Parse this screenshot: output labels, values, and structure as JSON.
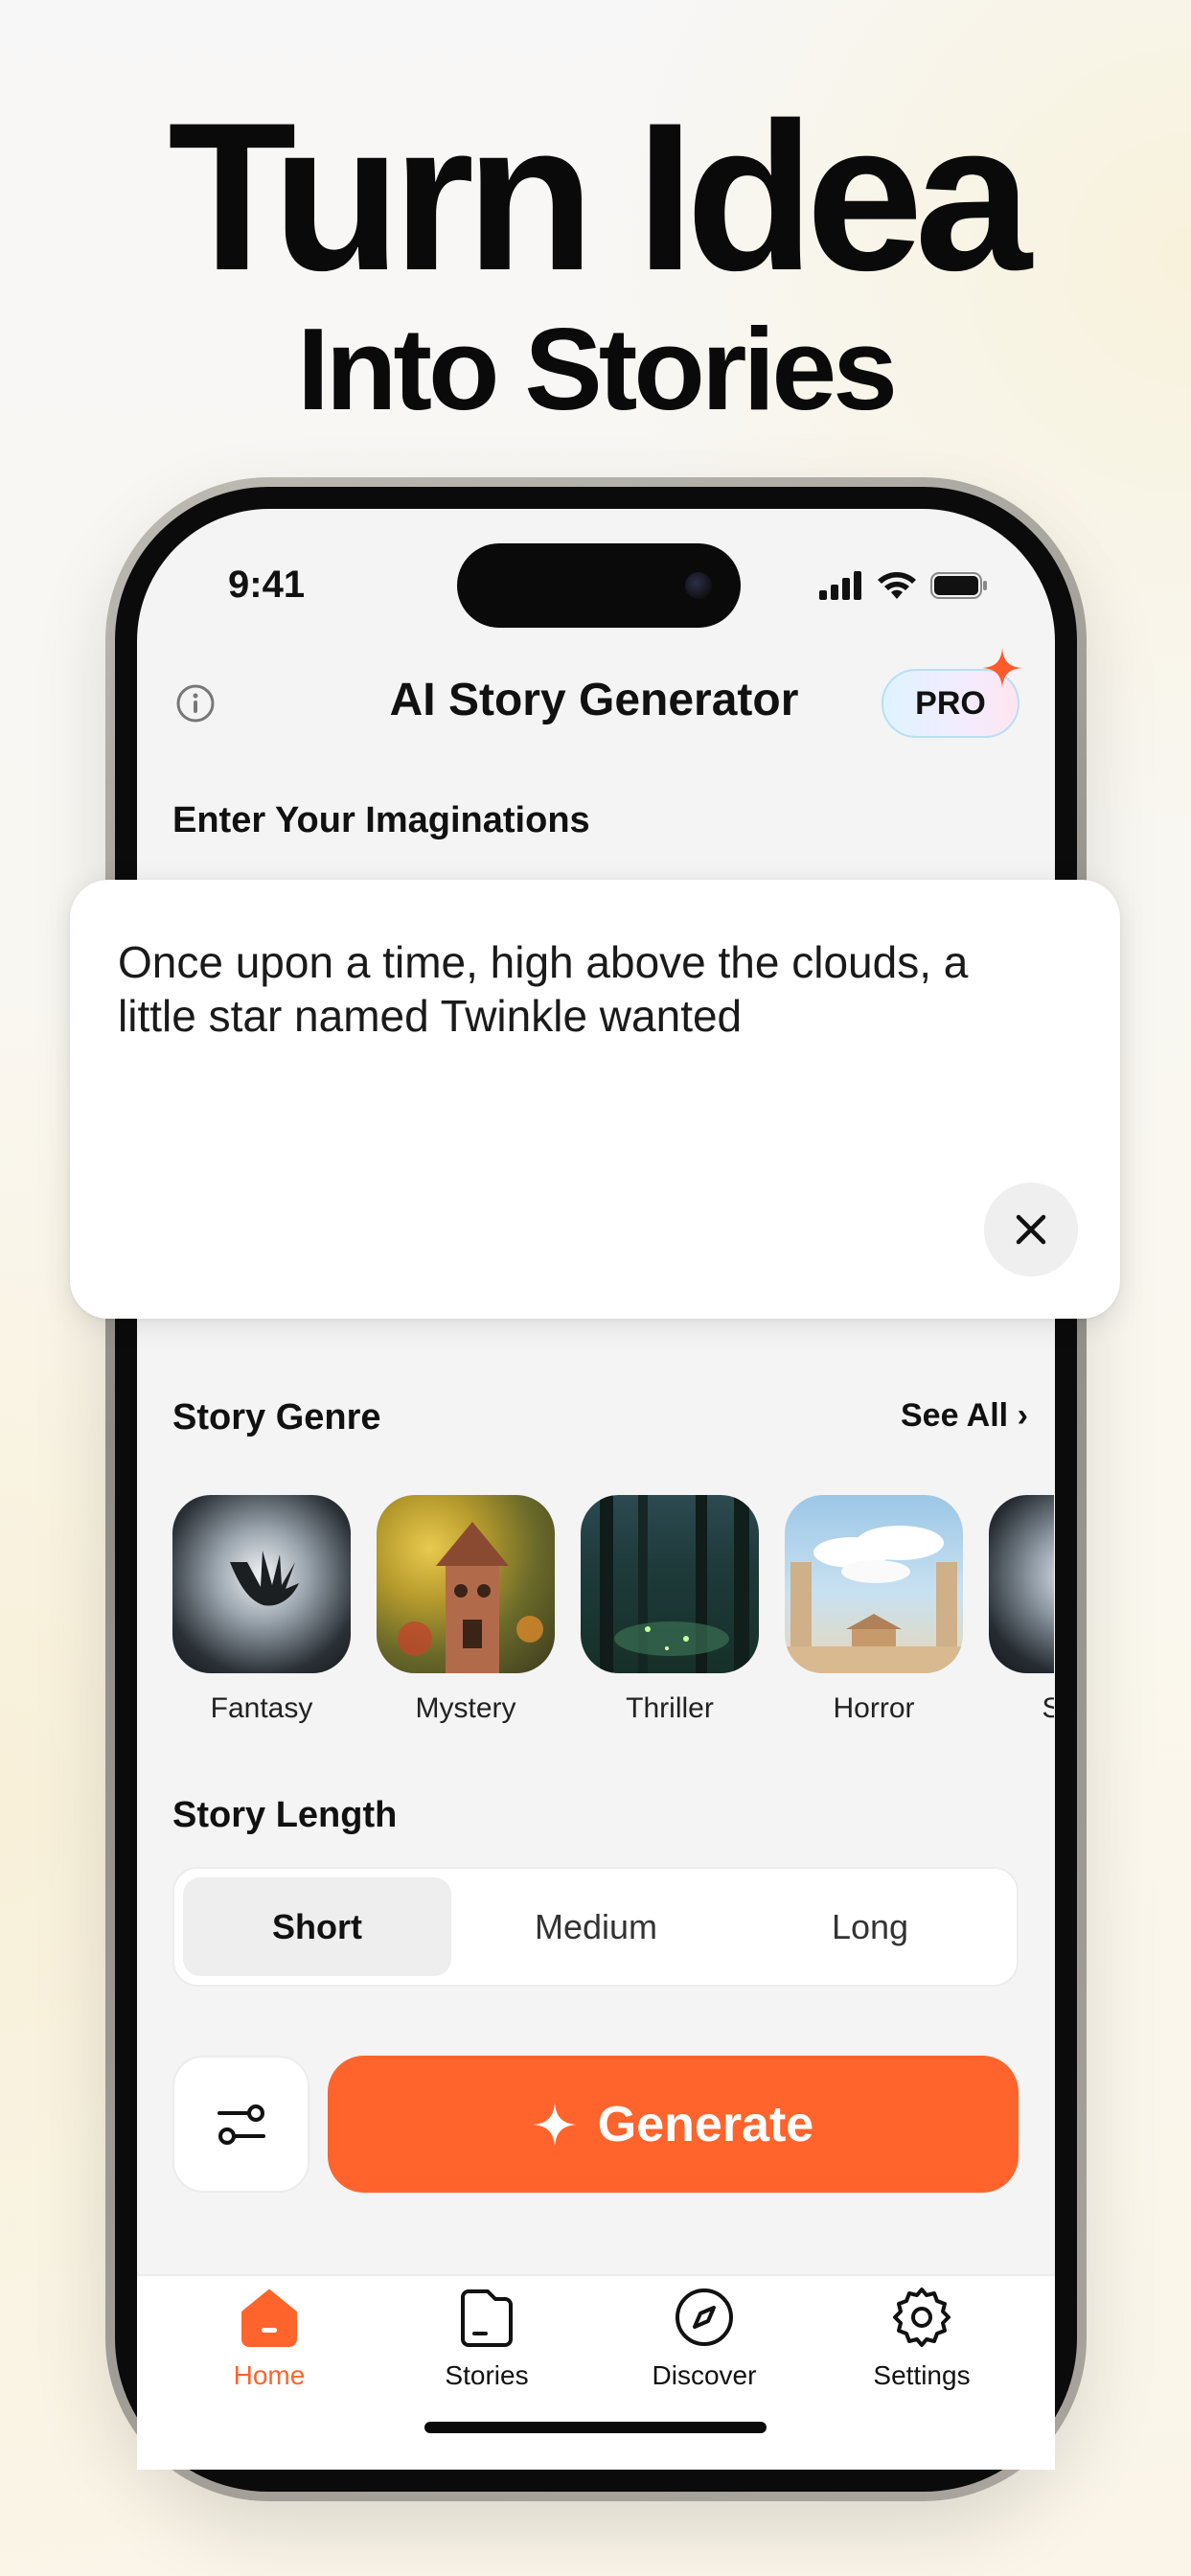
{
  "headline": {
    "line1": "Turn Idea",
    "line2": "Into Stories"
  },
  "status_bar": {
    "time": "9:41"
  },
  "header": {
    "title": "AI Story Generator",
    "pro_label": "PRO"
  },
  "prompt": {
    "label": "Enter Your Imaginations",
    "text": "Once upon a time, high above the clouds, a little star named Twinkle wanted"
  },
  "genre": {
    "label": "Story Genre",
    "see_all": "See All",
    "items": [
      {
        "name": "Fantasy"
      },
      {
        "name": "Mystery"
      },
      {
        "name": "Thriller"
      },
      {
        "name": "Horror"
      },
      {
        "name": "Scien"
      }
    ]
  },
  "length": {
    "label": "Story Length",
    "options": [
      "Short",
      "Medium",
      "Long"
    ],
    "selected": "Short"
  },
  "actions": {
    "generate_label": "Generate"
  },
  "tabs": [
    {
      "label": "Home",
      "icon": "home-icon",
      "active": true
    },
    {
      "label": "Stories",
      "icon": "folder-icon",
      "active": false
    },
    {
      "label": "Discover",
      "icon": "compass-icon",
      "active": false
    },
    {
      "label": "Settings",
      "icon": "gear-icon",
      "active": false
    }
  ],
  "colors": {
    "accent": "#ff642c",
    "background": "#f4f4f4"
  }
}
